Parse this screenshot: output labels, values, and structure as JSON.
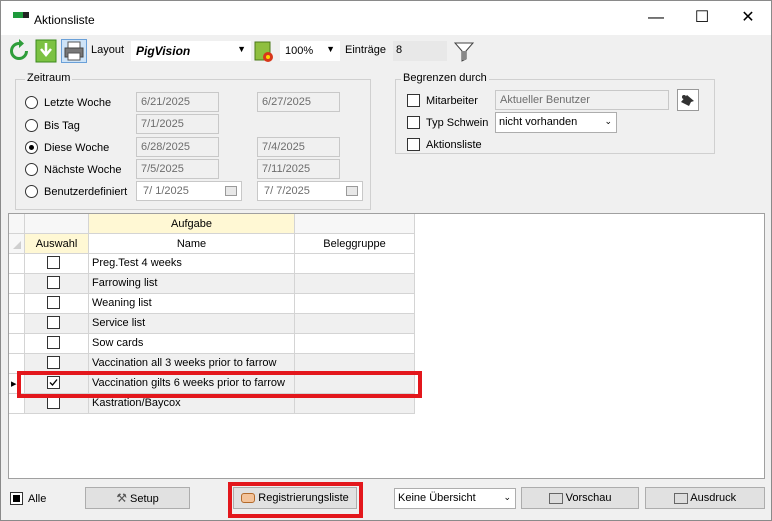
{
  "window": {
    "title": "Aktionsliste",
    "minimize": "—",
    "maximize": "☐",
    "close": "✕"
  },
  "toolbar": {
    "layout_label": "Layout",
    "layout_value": "PigVision",
    "zoom_value": "100%",
    "entries_label": "Einträge",
    "entries_value": "8"
  },
  "zeitraum": {
    "label": "Zeitraum",
    "options": [
      {
        "label": "Letzte Woche",
        "from": "6/21/2025",
        "to": "6/27/2025",
        "selected": false
      },
      {
        "label": "Bis Tag",
        "from": "7/1/2025",
        "to": "",
        "selected": false
      },
      {
        "label": "Diese Woche",
        "from": "6/28/2025",
        "to": "7/4/2025",
        "selected": true
      },
      {
        "label": "Nächste Woche",
        "from": "7/5/2025",
        "to": "7/11/2025",
        "selected": false
      },
      {
        "label": "Benutzerdefiniert",
        "from": "7/  1/2025",
        "to": "7/  7/2025",
        "selected": false
      }
    ]
  },
  "begrenzen": {
    "label": "Begrenzen durch",
    "mitarbeiter_label": "Mitarbeiter",
    "mitarbeiter_value": "Aktueller Benutzer",
    "typ_label": "Typ Schwein",
    "typ_value": "nicht vorhanden",
    "aktionsliste_label": "Aktionsliste"
  },
  "grid": {
    "group_header": "Aufgabe",
    "col_auswahl": "Auswahl",
    "col_name": "Name",
    "col_beleggruppe": "Beleggruppe",
    "rows": [
      {
        "name": "Preg.Test 4 weeks",
        "checked": false
      },
      {
        "name": "Farrowing list",
        "checked": false
      },
      {
        "name": "Weaning list",
        "checked": false
      },
      {
        "name": "Service list",
        "checked": false
      },
      {
        "name": "Sow cards",
        "checked": false
      },
      {
        "name": "Vaccination all 3 weeks prior to farrow",
        "checked": false
      },
      {
        "name": "Vaccination gilts 6 weeks prior to farrow",
        "checked": true
      },
      {
        "name": "Kastration/Baycox",
        "checked": false
      }
    ]
  },
  "footer": {
    "alle_label": "Alle",
    "setup_label": "Setup",
    "registrierungsliste_label": "Registrierungsliste",
    "overview_value": "Keine Übersicht",
    "vorschau_label": "Vorschau",
    "ausdruck_label": "Ausdruck"
  },
  "colors": {
    "highlight_red": "#e3171c",
    "header_yellow": "#fff8d4"
  }
}
